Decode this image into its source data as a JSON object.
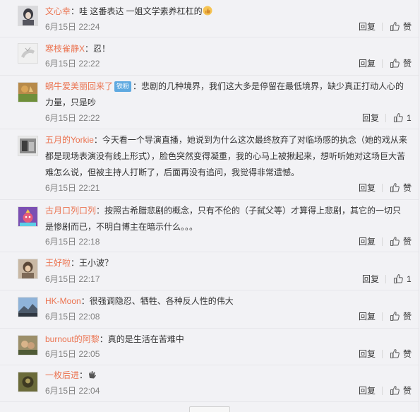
{
  "comments": [
    {
      "user": "文心幸",
      "badge": "",
      "content": "：哇 这番表达 一姐文学素养杠杠的",
      "content_emoji": "thumbs-up",
      "time": "6月15日 22:24",
      "reply": "回复",
      "like": "赞"
    },
    {
      "user": "寒枝雀静X",
      "badge": "",
      "content": "：忍！",
      "time": "6月15日 22:22",
      "reply": "回复",
      "like": "赞"
    },
    {
      "user": "蜗牛爱美丽回来了",
      "badge": "铁粉",
      "content": "：悲剧的几种境界，我们这大多是停留在最低境界，缺少真正打动人心的力量，只是吵",
      "time": "6月15日 22:22",
      "reply": "回复",
      "like": "1"
    },
    {
      "user": "五月的Yorkie",
      "badge": "",
      "content": "：今天看一个导演直播，她说到为什么这次最终放弃了对临场感的执念（她的戏从来都是现场表演没有线上形式），脸色突然变得凝重，我的心马上被揪起来，想听听她对这场巨大苦难怎么说，但被主持人打断了，后面再没有追问，我觉得非常遗憾。",
      "time": "6月15日 22:21",
      "reply": "回复",
      "like": "赞"
    },
    {
      "user": "古月口列口列",
      "badge": "",
      "content": "：按照古希腊悲剧的概念，只有不伦的（子弑父等）才算得上悲剧，其它的一切只是惨剧而已，不明白博主在暗示什么。。。",
      "time": "6月15日 22:18",
      "reply": "回复",
      "like": "赞"
    },
    {
      "user": "王好啦",
      "badge": "",
      "content": "：王小波？",
      "time": "6月15日 22:17",
      "reply": "回复",
      "like": "1"
    },
    {
      "user": "HK-Moon",
      "badge": "",
      "content": "：很强调隐忍、牺牲、各种反人性的伟大",
      "time": "6月15日 22:08",
      "reply": "回复",
      "like": "赞"
    },
    {
      "user": "burnout的阿黎",
      "badge": "",
      "content": "：真的是生活在苦难中",
      "time": "6月15日 22:05",
      "reply": "回复",
      "like": "赞"
    },
    {
      "user": "一枚后进",
      "badge": "",
      "content": "：",
      "content_emoji": "clapping-hands",
      "time": "6月15日 22:04",
      "reply": "回复",
      "like": "赞"
    }
  ],
  "colors": {
    "username": "#eb7350",
    "badge": "#5fa9e0",
    "meta": "#808080",
    "background": "#f2f2f5"
  }
}
